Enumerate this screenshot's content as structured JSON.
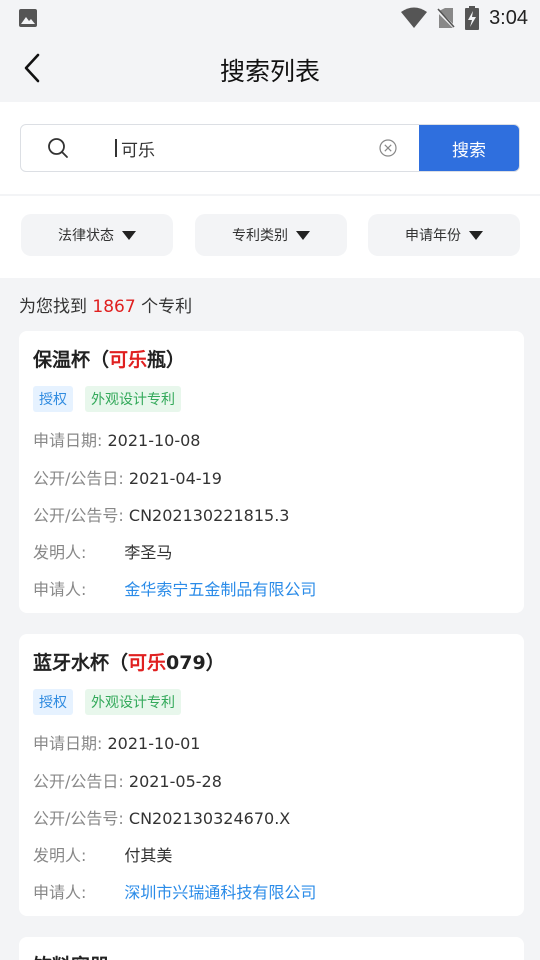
{
  "status_bar": {
    "time": "3:04"
  },
  "app_bar": {
    "title": "搜索列表"
  },
  "search": {
    "query": "可乐",
    "button_label": "搜索"
  },
  "filters": [
    {
      "label": "法律状态"
    },
    {
      "label": "专利类别"
    },
    {
      "label": "申请年份"
    }
  ],
  "result_summary": {
    "prefix": "为您找到",
    "count": "1867",
    "suffix": "个专利"
  },
  "labels": {
    "apply_date": "申请日期:",
    "pub_date": "公开/公告日:",
    "pub_no": "公开/公告号:",
    "inventor": "发明人:",
    "applicant": "申请人:"
  },
  "results": [
    {
      "title_before": "保温杯（",
      "title_highlight": "可乐",
      "title_after": "瓶）",
      "status_tag": "授权",
      "type_tag": "外观设计专利",
      "apply_date": "2021-10-08",
      "pub_date": "2021-04-19",
      "pub_no": "CN202130221815.3",
      "inventor": "李圣马",
      "applicant": "金华索宁五金制品有限公司"
    },
    {
      "title_before": "蓝牙水杯（",
      "title_highlight": "可乐",
      "title_after": "079）",
      "status_tag": "授权",
      "type_tag": "外观设计专利",
      "apply_date": "2021-10-01",
      "pub_date": "2021-05-28",
      "pub_no": "CN202130324670.X",
      "inventor": "付其美",
      "applicant": "深圳市兴瑞通科技有限公司"
    },
    {
      "title_before": "饮料容器"
    }
  ]
}
